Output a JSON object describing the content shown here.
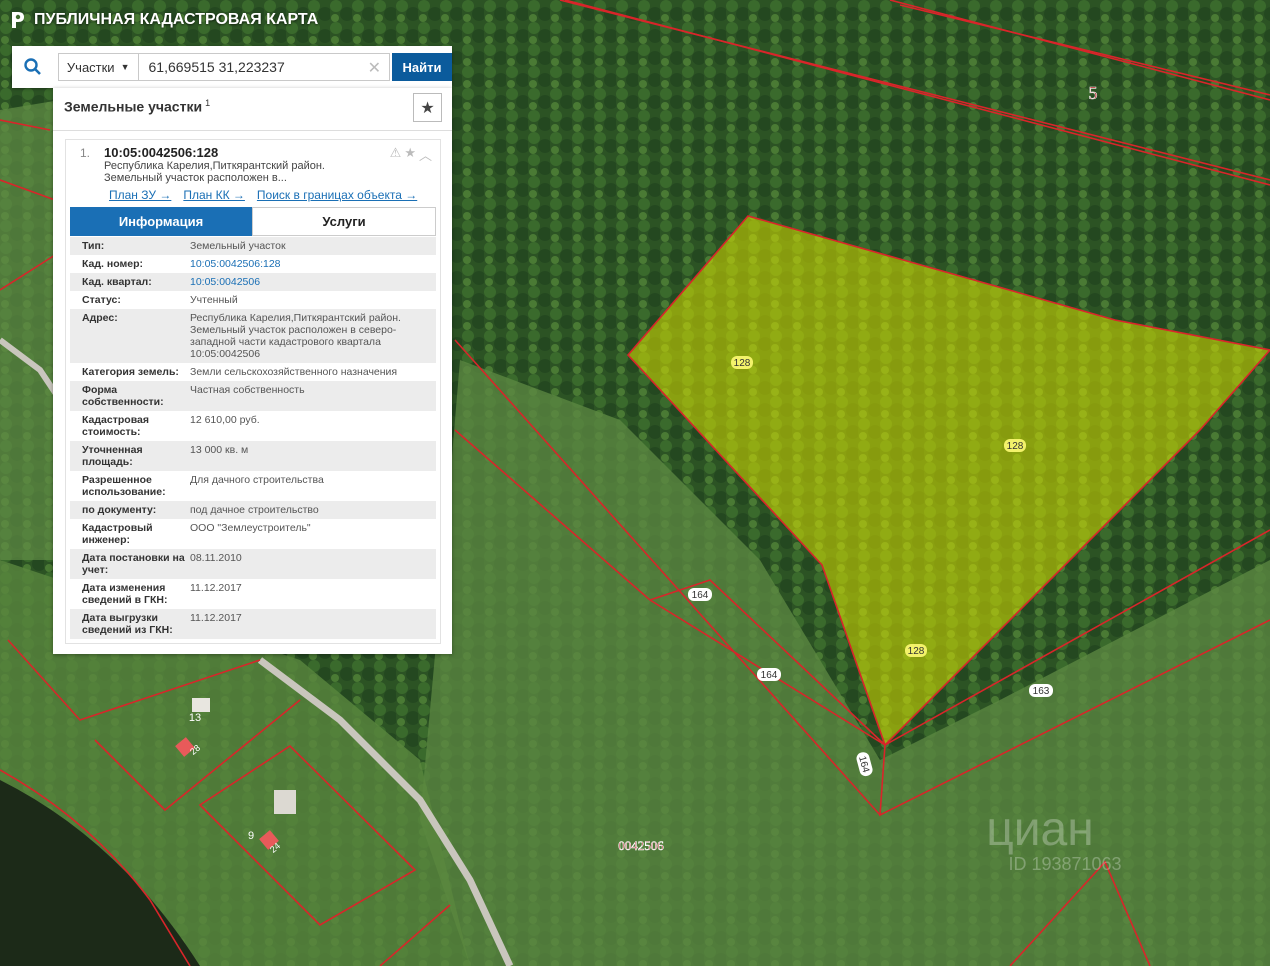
{
  "app": {
    "title": "ПУБЛИЧНАЯ КАДАСТРОВАЯ КАРТА"
  },
  "search": {
    "layer": "Участки",
    "query": "61,669515 31,223237",
    "find_label": "Найти"
  },
  "panel": {
    "title": "Земельные участки",
    "count": "1",
    "result": {
      "index": "1.",
      "number": "10:05:0042506:128",
      "desc_line1": "Республика Карелия,Питкярантский район.",
      "desc_line2": "Земельный участок расположен в...",
      "links": [
        "План ЗУ →",
        "План КК →",
        "Поиск в границах объекта →"
      ],
      "tabs": [
        "Информация",
        "Услуги"
      ],
      "rows": [
        {
          "label": "Тип:",
          "value": "Земельный участок"
        },
        {
          "label": "Кад. номер:",
          "value": "10:05:0042506:128"
        },
        {
          "label": "Кад. квартал:",
          "value": "10:05:0042506"
        },
        {
          "label": "Статус:",
          "value": "Учтенный"
        },
        {
          "label": "Адрес:",
          "value": "Республика Карелия,Питкярантский район. Земельный участок расположен в северо-западной части кадастрового квартала 10:05:0042506"
        },
        {
          "label": "Категория земель:",
          "value": "Земли сельскохозяйственного назначения"
        },
        {
          "label": "Форма собственности:",
          "value": "Частная собственность"
        },
        {
          "label": "Кадастровая стоимость:",
          "value": "12 610,00 руб."
        },
        {
          "label": "Уточненная площадь:",
          "value": "13 000 кв. м"
        },
        {
          "label": "Разрешенное использование:",
          "value": "Для дачного строительства"
        },
        {
          "label": "по документу:",
          "value": "под дачное строительство"
        },
        {
          "label": "Кадастровый инженер:",
          "value": "ООО \"Землеустроитель\""
        },
        {
          "label": "Дата постановки на учет:",
          "value": "08.11.2010"
        },
        {
          "label": "Дата изменения сведений в ГКН:",
          "value": "11.12.2017"
        },
        {
          "label": "Дата выгрузки сведений из ГКН:",
          "value": "11.12.2017"
        }
      ]
    }
  },
  "map": {
    "labels": {
      "parcel_a": "128",
      "parcel_b": "128",
      "parcel_c": "128",
      "p164_a": "164",
      "p164_b": "164",
      "p164_c": "164",
      "p163": "163",
      "p13": "13",
      "p28": "28",
      "p9": "9",
      "p24": "24",
      "quarter": "0042506",
      "zone5": "5",
      "watermark": "циан",
      "watermark_id": "ID 193871063"
    },
    "colors": {
      "boundary": "#d9252a",
      "selected_fill": "#d8e000",
      "road": "#c9c6bd"
    }
  }
}
